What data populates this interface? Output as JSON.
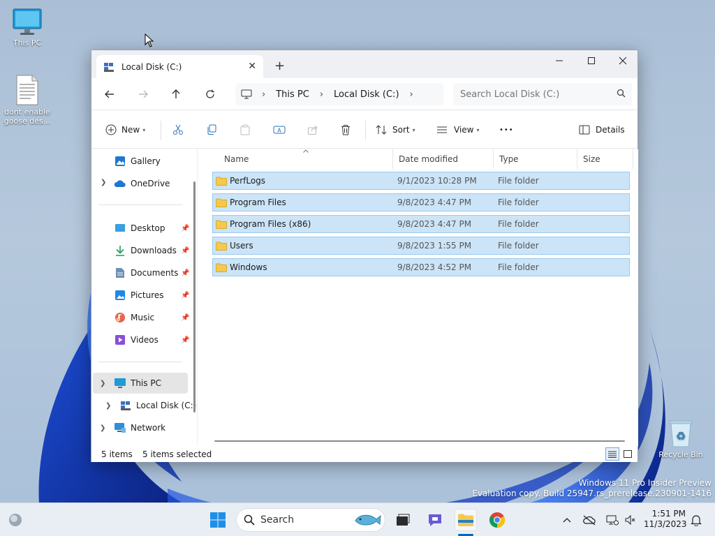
{
  "desktop": {
    "icons": [
      {
        "label": "This PC"
      },
      {
        "label": "dont enable goose des..."
      },
      {
        "label": "Recycle Bin"
      }
    ],
    "watermark": {
      "line1": "Windows 11 Pro Insider Preview",
      "line2": "Evaluation copy. Build 25947.rs_prerelease.230901-1416"
    }
  },
  "window": {
    "tab_title": "Local Disk (C:)",
    "new_tab": "+",
    "breadcrumb": [
      "This PC",
      "Local Disk (C:)"
    ],
    "search_placeholder": "Search Local Disk (C:)",
    "toolbar": {
      "new_label": "New",
      "sort_label": "Sort",
      "view_label": "View",
      "more_label": "•••",
      "details_label": "Details"
    },
    "sidebar": {
      "top": [
        {
          "label": "Gallery"
        },
        {
          "label": "OneDrive"
        }
      ],
      "quick": [
        {
          "label": "Desktop"
        },
        {
          "label": "Downloads"
        },
        {
          "label": "Documents"
        },
        {
          "label": "Pictures"
        },
        {
          "label": "Music"
        },
        {
          "label": "Videos"
        }
      ],
      "tree": [
        {
          "label": "This PC"
        },
        {
          "label": "Local Disk (C:)"
        },
        {
          "label": "Network"
        }
      ]
    },
    "columns": {
      "name": "Name",
      "date": "Date modified",
      "type": "Type",
      "size": "Size"
    },
    "files": [
      {
        "name": "PerfLogs",
        "date": "9/1/2023 10:28 PM",
        "type": "File folder"
      },
      {
        "name": "Program Files",
        "date": "9/8/2023 4:47 PM",
        "type": "File folder"
      },
      {
        "name": "Program Files (x86)",
        "date": "9/8/2023 4:47 PM",
        "type": "File folder"
      },
      {
        "name": "Users",
        "date": "9/8/2023 1:55 PM",
        "type": "File folder"
      },
      {
        "name": "Windows",
        "date": "9/8/2023 4:52 PM",
        "type": "File folder"
      }
    ],
    "status": {
      "count": "5 items",
      "selected": "5 items selected"
    }
  },
  "taskbar": {
    "search_label": "Search",
    "time": "1:51 PM",
    "date": "11/3/2023"
  },
  "colors": {
    "selection_bg": "#cce4f7",
    "selection_border": "#99c9ef",
    "accent": "#0067c0",
    "folder": "#f6c94e"
  }
}
